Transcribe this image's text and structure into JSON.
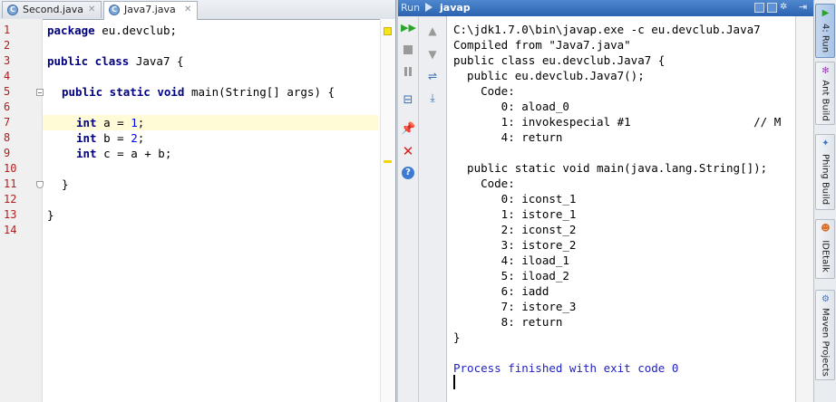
{
  "editor": {
    "tabs": [
      {
        "label": "Second.java",
        "active": false
      },
      {
        "label": "Java7.java",
        "active": true
      }
    ],
    "line_numbers": [
      "1",
      "2",
      "3",
      "4",
      "5",
      "6",
      "7",
      "8",
      "9",
      "10",
      "11",
      "12",
      "13",
      "14"
    ],
    "code": {
      "l1_kw": "package",
      "l1_rest": " eu.devclub;",
      "l3_kw": "public class",
      "l3_rest": " Java7 {",
      "l5_kw": "public static void",
      "l5_rest": " main(String[] args) {",
      "l7_kw": "int",
      "l7_rest": " a = ",
      "l7_num": "1",
      "l7_end": ";",
      "l8_kw": "int",
      "l8_rest": " b = ",
      "l8_num": "2",
      "l8_end": ";",
      "l9_kw": "int",
      "l9_rest": " c = a + b;",
      "l11": "}",
      "l13": "}"
    }
  },
  "run_panel": {
    "run_label": "Run",
    "config_name": "javap",
    "console_lines": [
      "C:\\jdk1.7.0\\bin\\javap.exe -c eu.devclub.Java7",
      "Compiled from \"Java7.java\"",
      "public class eu.devclub.Java7 {",
      "  public eu.devclub.Java7();",
      "    Code:",
      "       0: aload_0",
      "       1: invokespecial #1                  // M",
      "       4: return",
      "",
      "  public static void main(java.lang.String[]);",
      "    Code:",
      "       0: iconst_1",
      "       1: istore_1",
      "       2: iconst_2",
      "       3: istore_2",
      "       4: iload_1",
      "       5: iload_2",
      "       6: iadd",
      "       7: istore_3",
      "       8: return",
      "}",
      "",
      "Process finished with exit code 0"
    ]
  },
  "side_tabs": [
    {
      "label": "4: Run",
      "icon": "run-icon",
      "active": true
    },
    {
      "label": "Ant Build",
      "icon": "ant-icon",
      "active": false
    },
    {
      "label": "Phing Build",
      "icon": "phing-icon",
      "active": false
    },
    {
      "label": "IDEtalk",
      "icon": "idetalk-icon",
      "active": false
    },
    {
      "label": "Maven Projects",
      "icon": "maven-icon",
      "active": false
    }
  ],
  "colors": {
    "keyword": "#000080",
    "number": "#0000ff",
    "line_number": "#b02020",
    "process_message": "#1f1fbf",
    "caret_line": "#fffbd7"
  }
}
